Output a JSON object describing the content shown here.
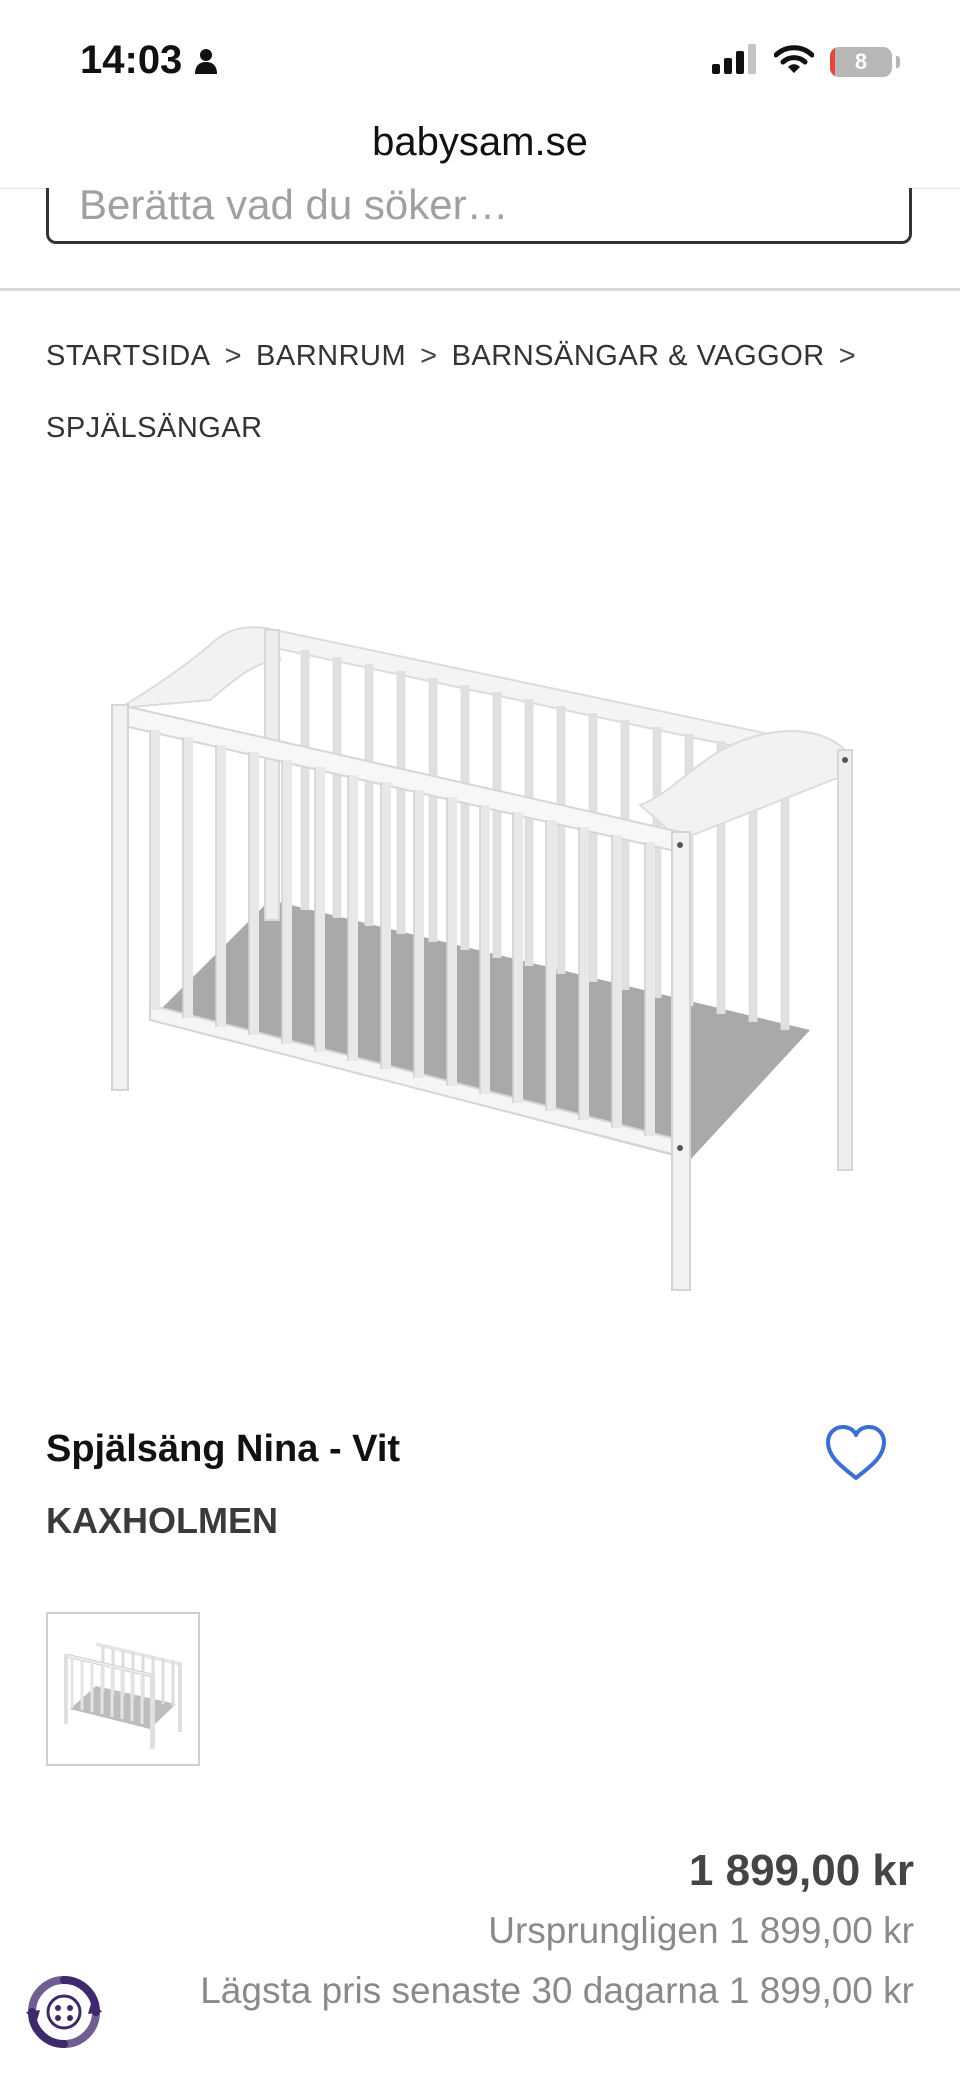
{
  "status_bar": {
    "time": "14:03",
    "battery_level": "8",
    "battery_fraction": 0.08,
    "signal_bars_active": 3,
    "signal_bars_total": 4
  },
  "browser": {
    "url": "babysam.se"
  },
  "search": {
    "placeholder": "Berätta vad du söker…"
  },
  "breadcrumb": {
    "separator": ">",
    "items": [
      "STARTSIDA",
      "BARNRUM",
      "BARNSÄNGAR & VAGGOR",
      "SPJÄLSÄNGAR"
    ]
  },
  "product": {
    "title": "Spjälsäng Nina - Vit",
    "brand": "KAXHOLMEN",
    "price": "1 899,00 kr",
    "original_price_line": "Ursprungligen 1 899,00 kr",
    "lowest_price_line": "Lägsta pris senaste 30 dagarna 1 899,00 kr"
  },
  "colors": {
    "favorite_icon": "#3b6fd1",
    "chat_widget": "#3d2a6b",
    "battery_low": "#e5453b"
  },
  "icons": {
    "person": "person-icon",
    "signal": "signal-icon",
    "wifi": "wifi-icon",
    "battery": "battery-icon",
    "favorite": "heart-icon",
    "chat": "chat-widget-icon"
  }
}
